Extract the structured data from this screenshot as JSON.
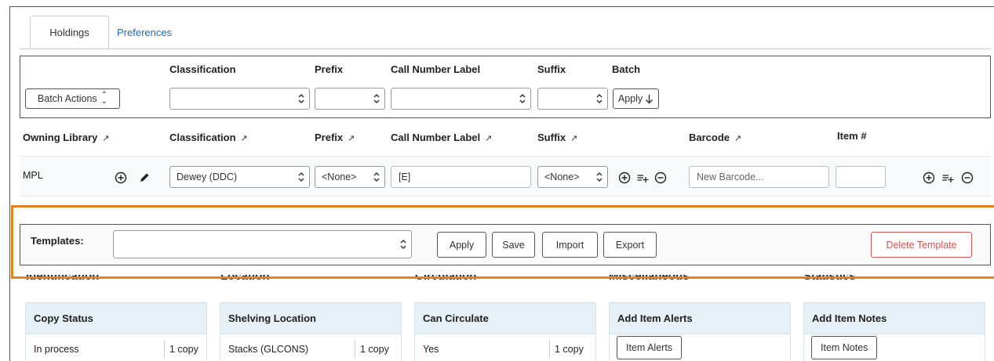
{
  "tabs": [
    {
      "label": "Holdings",
      "active": true
    },
    {
      "label": "Preferences",
      "active": false
    }
  ],
  "batch": {
    "actions_label": "Batch Actions",
    "col_classification": "Classification",
    "col_prefix": "Prefix",
    "col_call_number_label": "Call Number Label",
    "col_suffix": "Suffix",
    "col_batch": "Batch",
    "classification_value": "",
    "prefix_value": "",
    "call_number_value": "",
    "suffix_value": "",
    "apply_label": "Apply"
  },
  "columns": {
    "owning_library": "Owning Library",
    "classification": "Classification",
    "prefix": "Prefix",
    "call_number_label": "Call Number Label",
    "suffix": "Suffix",
    "barcode": "Barcode",
    "item_number": "Item #"
  },
  "row": {
    "owning_library": "MPL",
    "classification": "Dewey (DDC)",
    "prefix": "<None>",
    "call_number_label": "[E]",
    "suffix": "<None>",
    "barcode_placeholder": "New Barcode...",
    "item_number": ""
  },
  "templates": {
    "label": "Templates:",
    "selected": "",
    "apply": "Apply",
    "save": "Save",
    "import": "Import",
    "export": "Export",
    "delete": "Delete Template"
  },
  "sections": {
    "identification": "Identification",
    "location": "Location",
    "circulation": "Circulation",
    "miscellaneous": "Miscellaneous",
    "statistics": "Statistics"
  },
  "cards": {
    "copy_status": {
      "title": "Copy Status",
      "value": "In process",
      "count": "1 copy"
    },
    "shelving_location": {
      "title": "Shelving Location",
      "value": "Stacks (GLCONS)",
      "count": "1 copy"
    },
    "can_circulate": {
      "title": "Can Circulate",
      "value": "Yes",
      "count": "1 copy"
    },
    "item_alerts": {
      "title": "Add Item Alerts",
      "button": "Item Alerts"
    },
    "item_notes": {
      "title": "Add Item Notes",
      "button": "Item Notes"
    }
  },
  "colors": {
    "accent_link": "#1a6bbf",
    "highlight_orange": "#e8821e",
    "danger": "#d9534f",
    "card_header": "#e6f0f7"
  },
  "icons": {
    "sort": "arrow-up-right-icon",
    "add": "plus-circle-icon",
    "edit": "pencil-icon",
    "remove": "minus-circle-icon",
    "multi_add": "list-add-icon",
    "apply": "arrow-down-icon",
    "select": "chevron-up-down-icon"
  }
}
